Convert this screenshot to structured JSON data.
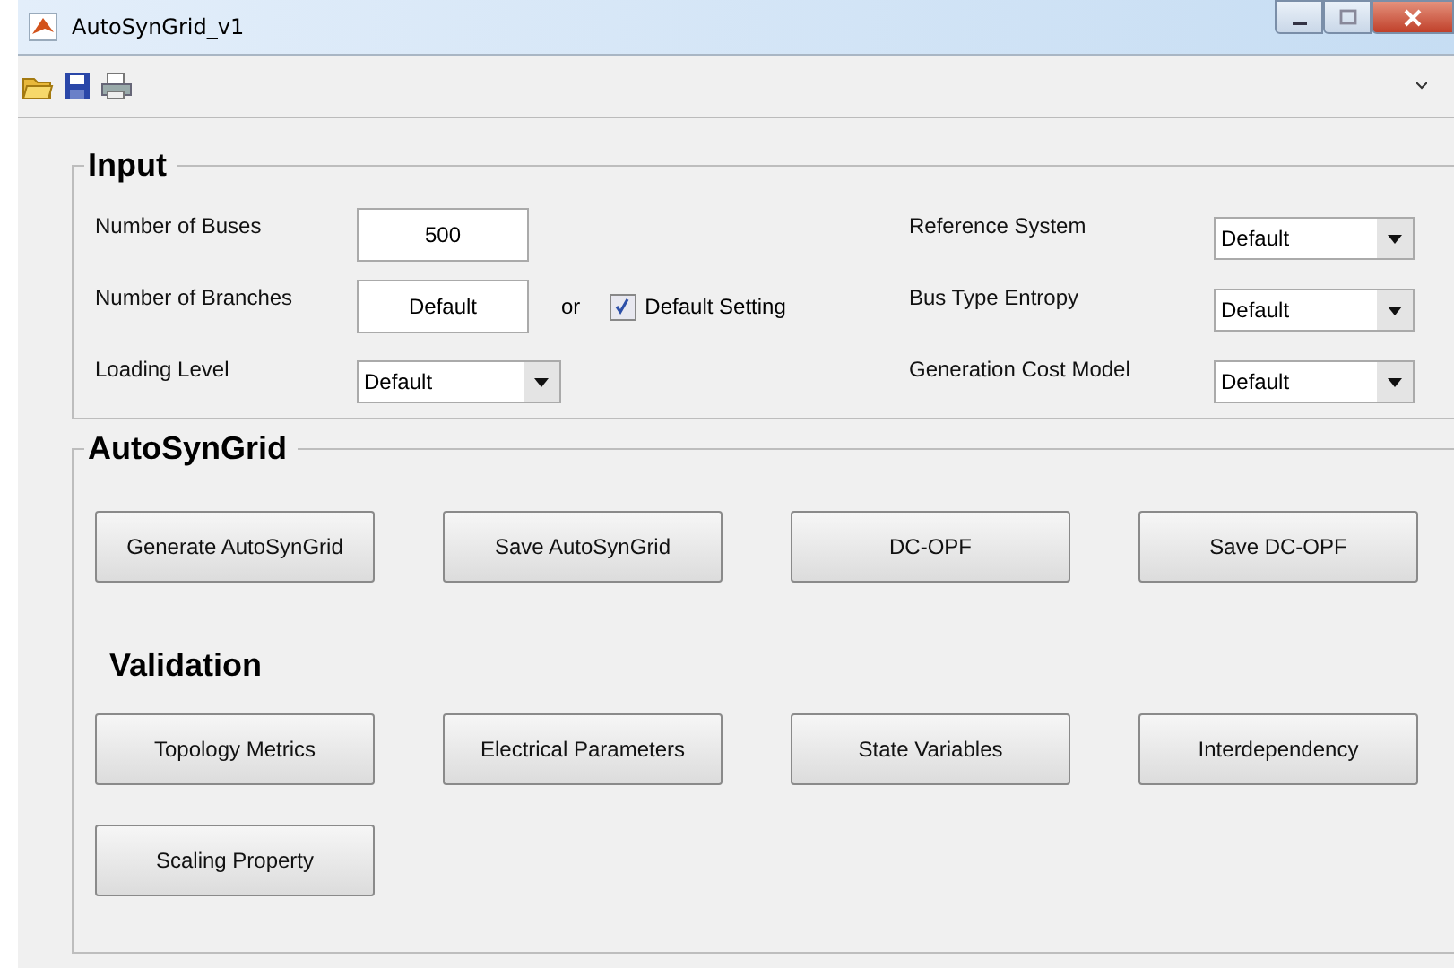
{
  "window": {
    "title": "AutoSynGrid_v1"
  },
  "input": {
    "title": "Input",
    "number_of_buses": {
      "label": "Number of Buses",
      "value": "500"
    },
    "number_of_branches": {
      "label": "Number of  Branches",
      "value": "Default"
    },
    "or_label": "or",
    "default_setting": {
      "label": "Default Setting",
      "checked": true
    },
    "loading_level": {
      "label": "Loading Level",
      "value": "Default"
    },
    "right_dropdowns": [
      {
        "label": "Reference System",
        "value": "Default"
      },
      {
        "label": "Bus Type Entropy",
        "value": "Default"
      },
      {
        "label": "Generation Cost Model",
        "value": "Default"
      }
    ]
  },
  "autosyngrid": {
    "title": "AutoSynGrid",
    "buttons": [
      "Generate AutoSynGrid",
      "Save AutoSynGrid",
      "DC-OPF",
      "Save DC-OPF"
    ],
    "validation_title": "Validation",
    "validation_buttons": [
      "Topology Metrics",
      "Electrical Parameters",
      "State Variables",
      "Interdependency",
      "Scaling Property"
    ]
  }
}
